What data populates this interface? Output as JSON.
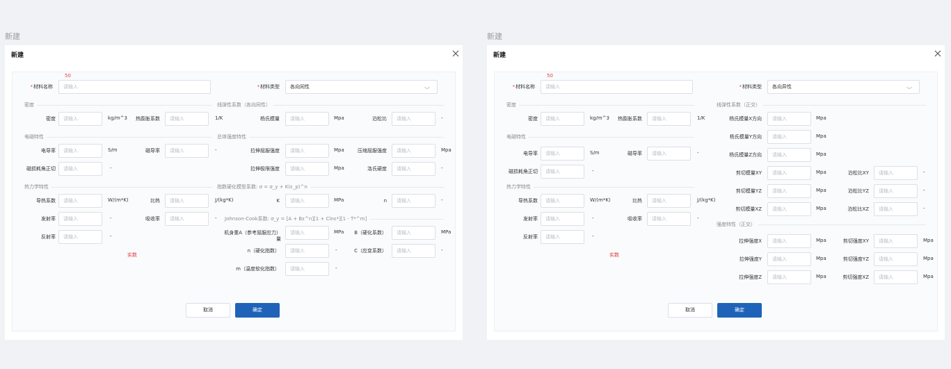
{
  "left_caption": "新建",
  "right_caption": "新建",
  "dialog_title": "新建",
  "placeholder": "请输入",
  "annot_50": "50",
  "annot_shidu": "实数",
  "cancel_label": "取消",
  "ok_label": "确定",
  "name_label": "材料名称",
  "type_label": "材料类型",
  "left": {
    "type_value": "各向同性",
    "sec_density": "密度",
    "sec_elastic": "线弹性系数（各向同性）",
    "sec_em": "电磁特性",
    "sec_strength": "总体强度特性",
    "sec_thermal": "热力学特性",
    "sec_hardening": "指数硬化模型系数:  σ = σ_y + K(ε_p)^n",
    "sec_jc": "Johnson-Cook系数:  σ_y = [A + Bε^n][1 + Clnε*][1 - T*^m]",
    "density_label": "密度",
    "density_unit": "kg/m^3",
    "thexp_label": "热膨胀系数",
    "thexp_unit": "1/K",
    "young_label": "杨氏模量",
    "young_unit": "Mpa",
    "poisson_label": "泊松比",
    "poisson_unit": "-",
    "cond_label": "电导率",
    "cond_unit": "S/m",
    "perm_label": "磁导率",
    "perm_unit": "-",
    "losst_label": "磁损耗角正切",
    "losst_unit": "-",
    "tys_label": "拉伸屈服强度",
    "tys_unit": "Mpa",
    "cys_label": "压缩屈服强度",
    "cys_unit": "Mpa",
    "uts_label": "拉伸极限强度",
    "uts_unit": "Mpa",
    "hard_label": "洛氏硬度",
    "hard_unit": "-",
    "tc_label": "导热系数",
    "tc_unit": "W/(m*K)",
    "sh_label": "比热",
    "sh_unit": "J/(kg*K)",
    "k_label": "K",
    "k_unit": "MPa",
    "n_label": "n",
    "n_unit": "-",
    "emis_label": "发射率",
    "emis_unit": "-",
    "abs_label": "吸收率",
    "abs_unit": "-",
    "refl_label": "反射率",
    "refl_unit": "-",
    "jca_label": "机身重A（参考屈服应力）量",
    "jca_unit": "MPa",
    "jcb_label": "B（硬化系数）",
    "jcb_unit": "MPa",
    "jcn_label": "n（硬化指数）",
    "jcn_unit": "-",
    "jcc_label": "C（应变系数）",
    "jcc_unit": "-",
    "jcm_label": "m（温度软化指数）",
    "jcm_unit": "-"
  },
  "right": {
    "type_value": "各向异性",
    "sec_density": "密度",
    "sec_elastic": "线弹性系数（正交）",
    "sec_em": "电磁特性",
    "sec_thermal": "热力学特性",
    "sec_strength": "强度特性（正交）",
    "density_label": "密度",
    "density_unit": "kg/m^3",
    "thexp_label": "热膨胀系数",
    "thexp_unit": "1/K",
    "cond_label": "电导率",
    "cond_unit": "S/m",
    "perm_label": "磁导率",
    "perm_unit": "-",
    "losst_label": "磁损耗角正切",
    "losst_unit": "-",
    "tc_label": "导热系数",
    "tc_unit": "W/(m*K)",
    "sh_label": "比热",
    "sh_unit": "J/(kg*K)",
    "emis_label": "发射率",
    "emis_unit": "-",
    "abs_label": "吸收率",
    "abs_unit": "-",
    "refl_label": "反射率",
    "refl_unit": "-",
    "ex_label": "杨氏模量X方向",
    "ey_label": "杨氏模量Y方向",
    "ez_label": "杨氏模量Z方向",
    "gxy_label": "剪切模量XY",
    "gyz_label": "剪切模量YZ",
    "gxz_label": "剪切模量XZ",
    "nuxy_label": "泊松比XY",
    "nuyz_label": "泊松比YZ",
    "nuxz_label": "泊松比XZ",
    "mpa_unit": "Mpa",
    "dash_unit": "-",
    "tx_label": "拉伸强度X",
    "ty_label": "拉伸强度Y",
    "tz_label": "拉伸强度Z",
    "sxy_label": "剪切强度XY",
    "syz_label": "剪切强度YZ",
    "sxz_label": "剪切强度XZ"
  }
}
